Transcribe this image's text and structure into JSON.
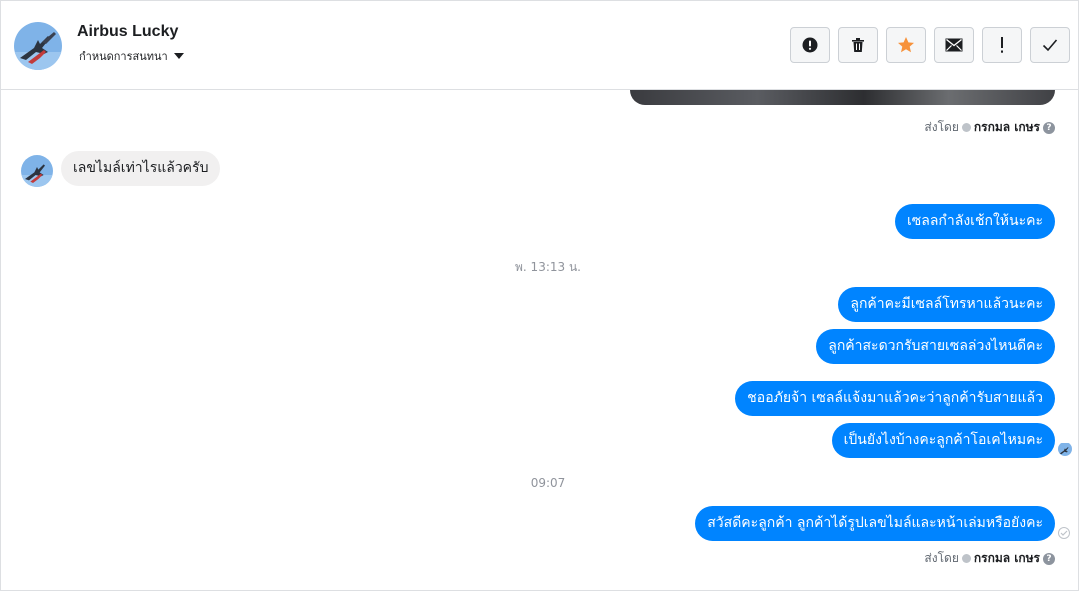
{
  "header": {
    "name": "Airbus Lucky",
    "subtitle": "กำหนดการสนทนา",
    "toolbar": [
      {
        "icon": "exclamation-circle-icon",
        "label": "Spam"
      },
      {
        "icon": "trash-icon",
        "label": "Delete"
      },
      {
        "icon": "star-icon",
        "label": "Star",
        "color": "#f7923b"
      },
      {
        "icon": "envelope-icon",
        "label": "Mark as unread"
      },
      {
        "icon": "exclamation-icon",
        "label": "Follow up"
      },
      {
        "icon": "check-icon",
        "label": "Done"
      }
    ]
  },
  "thread": {
    "sent_by_prefix": "ส่งโดย",
    "sender": "กรกมล เกษร",
    "messages": {
      "m1": "เลขไมล์เท่าไรแล้วครับ",
      "m2": "เซลลกำลังเช้กให้นะคะ",
      "ts1": "พ. 13:13 น.",
      "m3": "ลูกค้าคะมีเซลล์โทรหาแล้วนะคะ",
      "m4": "ลูกค้าสะดวกรับสายเซลล่วงไหนดีคะ",
      "m5": "ชออภัยจ้า เซลล์แจ้งมาแล้วคะว่าลูกค้ารับสายแล้ว",
      "m6": "เป็นยังไงบ้างคะลูกค้าโอเคไหมคะ",
      "ts2": "09:07",
      "m7": "สวัสดีคะลูกค้า ลูกค้าได้รูปเลขไมล์และหน้าเล่มหรือยังคะ"
    }
  },
  "colors": {
    "outgoing_bubble": "#0084ff",
    "incoming_bubble": "#f1f0f0",
    "star": "#f7923b"
  }
}
